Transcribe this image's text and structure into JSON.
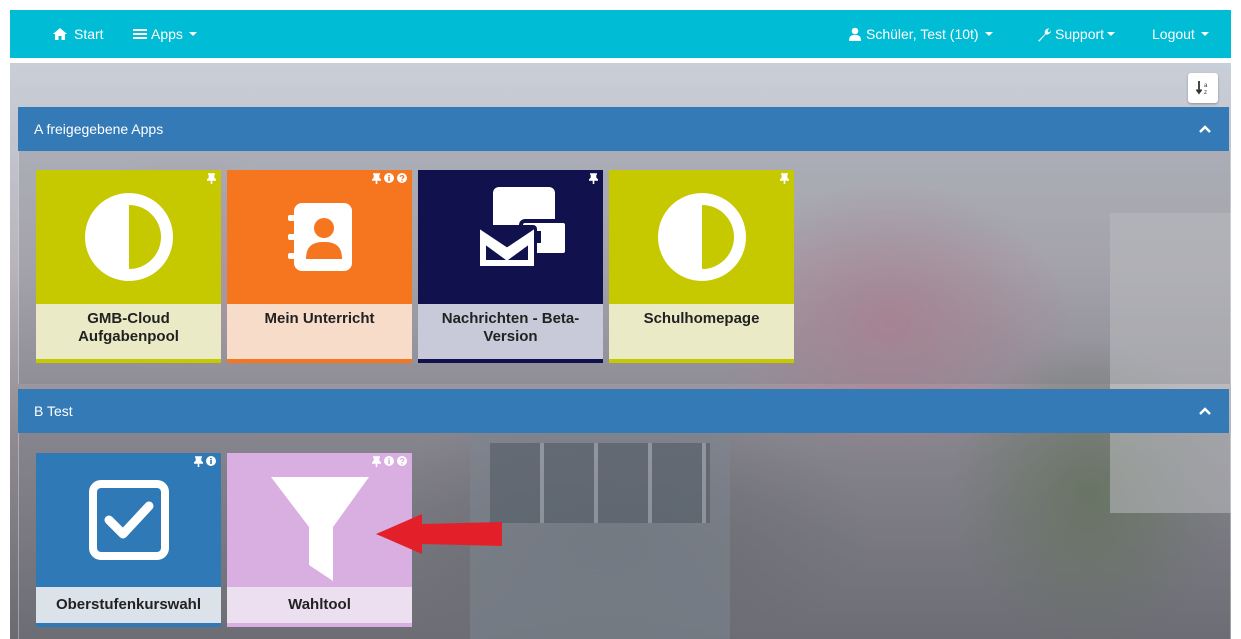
{
  "navbar": {
    "start_label": "Start",
    "apps_label": "Apps",
    "user_label": "Schüler, Test (10t)",
    "support_label": "Support",
    "logout_label": "Logout"
  },
  "panels": [
    {
      "title": "A freigegebene Apps",
      "tiles": [
        {
          "label": "GMB-Cloud Aufgabenpool",
          "icon": "half-circle-icon",
          "color": "#c6c800",
          "label_bg": "#ebeac6"
        },
        {
          "label": "Mein Unterricht",
          "icon": "contact-book-icon",
          "color": "#f5761f",
          "label_bg": "#f7dcc9"
        },
        {
          "label": "Nachrichten - Beta-Version",
          "icon": "messages-icon",
          "color": "#10114d",
          "label_bg": "#c9cad9"
        },
        {
          "label": "Schulhomepage",
          "icon": "half-circle-icon",
          "color": "#c6c800",
          "label_bg": "#ebeac6"
        }
      ]
    },
    {
      "title": "B Test",
      "tiles": [
        {
          "label": "Oberstufenkurswahl",
          "icon": "checkbox-icon",
          "color": "#2f79b6",
          "label_bg": "#dbe2ea"
        },
        {
          "label": "Wahltool",
          "icon": "funnel-icon",
          "color": "#d9aee0",
          "label_bg": "#ecdff0"
        }
      ]
    }
  ],
  "colors": {
    "navbar": "#00bcd4",
    "panel_header": "#337ab7",
    "annotation_arrow": "#e3202a"
  }
}
